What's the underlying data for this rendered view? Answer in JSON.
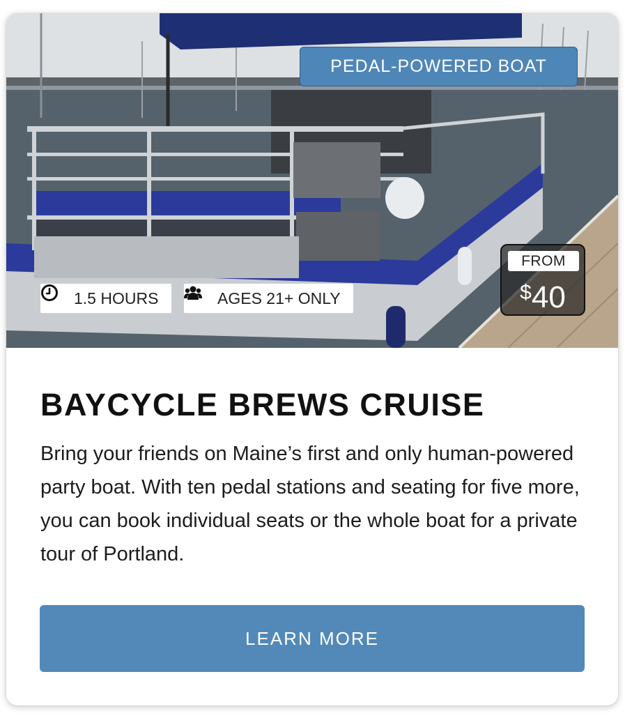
{
  "card": {
    "category": "PEDAL-POWERED BOAT",
    "price": {
      "from_label": "FROM",
      "currency": "$",
      "amount": "40"
    },
    "chips": {
      "duration": {
        "icon": "clock-icon",
        "label": "1.5 HOURS"
      },
      "ages": {
        "icon": "group-icon",
        "label": "AGES 21+ ONLY"
      }
    },
    "title": "BAYCYCLE BREWS CRUISE",
    "description": "Bring your friends on Maine’s first and only human-powered party boat. With ten pedal stations and seating for five more, you can book individual seats or the whole boat for a private tour of Portland.",
    "cta_label": "LEARN MORE"
  },
  "colors": {
    "accent": "#5289b9",
    "badge": "#4f86b8",
    "boat_hull": "#2c3a9c",
    "title_text": "#111111"
  }
}
